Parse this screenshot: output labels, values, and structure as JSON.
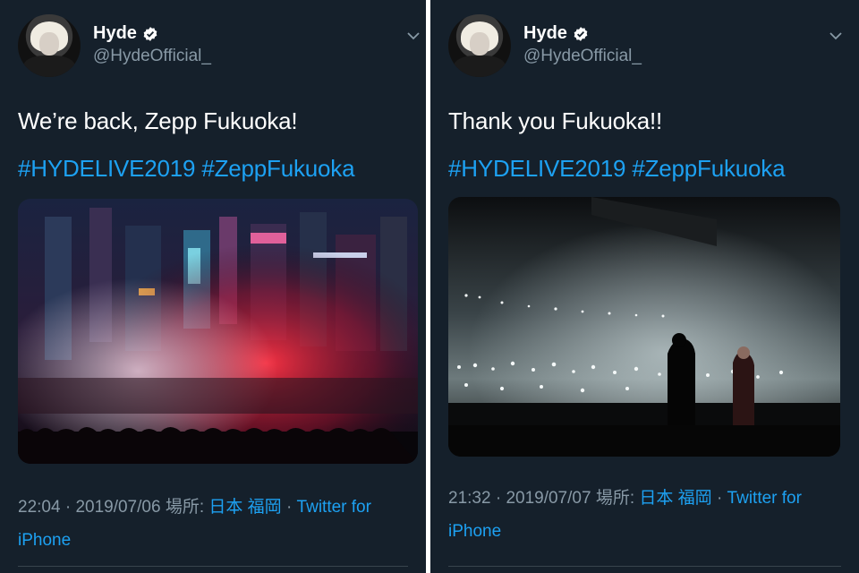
{
  "tweets": [
    {
      "name": "Hyde",
      "handle": "@HydeOfficial_",
      "text": "We’re back, Zepp Fukuoka!",
      "hashtags": "#HYDELIVE2019 #ZeppFukuoka",
      "time": "22:04",
      "date": "2019/07/06",
      "location_label": "場所:",
      "location": "日本 福岡",
      "source_line1": "Twitter for",
      "source_line2": "iPhone"
    },
    {
      "name": "Hyde",
      "handle": "@HydeOfficial_",
      "text": "Thank you Fukuoka!!",
      "hashtags": "#HYDELIVE2019 #ZeppFukuoka",
      "time": "21:32",
      "date": "2019/07/07",
      "location_label": "場所:",
      "location": "日本 福岡",
      "source_line1": "Twitter for",
      "source_line2": "iPhone"
    }
  ],
  "separator": "·",
  "colors": {
    "background": "#15202b",
    "link": "#1da1f2",
    "muted": "#8899a6",
    "verified": "#ffffff"
  },
  "icons": {
    "verified": "verified-badge-icon",
    "caret": "chevron-down-icon"
  }
}
